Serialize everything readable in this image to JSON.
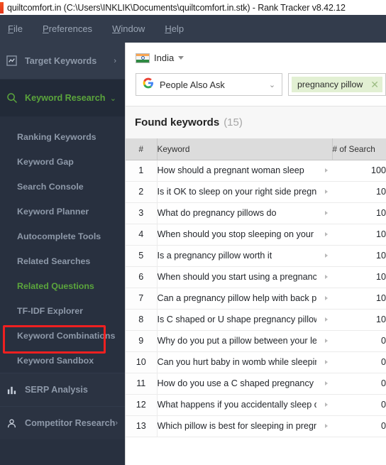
{
  "window": {
    "title": "quiltcomfort.in (C:\\Users\\INKLIK\\Documents\\quiltcomfort.in.stk) - Rank Tracker v8.42.12",
    "app_icon": "app-icon"
  },
  "menubar": {
    "items": [
      {
        "label": "File",
        "accel": "F"
      },
      {
        "label": "Preferences",
        "accel": "P"
      },
      {
        "label": "Window",
        "accel": "W"
      },
      {
        "label": "Help",
        "accel": "H"
      }
    ]
  },
  "sidebar": {
    "target_keywords": {
      "label": "Target Keywords",
      "icon": "chart-square-icon",
      "chevron": "›"
    },
    "keyword_research": {
      "label": "Keyword Research",
      "icon": "search-icon",
      "chevron": "⌄"
    },
    "subitems": [
      {
        "label": "Ranking Keywords",
        "selected": false
      },
      {
        "label": "Keyword Gap",
        "selected": false
      },
      {
        "label": "Search Console",
        "selected": false
      },
      {
        "label": "Keyword Planner",
        "selected": false
      },
      {
        "label": "Autocomplete Tools",
        "selected": false
      },
      {
        "label": "Related Searches",
        "selected": false
      },
      {
        "label": "Related Questions",
        "selected": true
      },
      {
        "label": "TF-IDF Explorer",
        "selected": false
      },
      {
        "label": "Keyword Combinations",
        "selected": false
      },
      {
        "label": "Keyword Sandbox",
        "selected": false
      }
    ],
    "serp_analysis": {
      "label": "SERP Analysis",
      "icon": "bar-chart-icon"
    },
    "competitor_research": {
      "label": "Competitor Research",
      "icon": "person-icon",
      "chevron": "›"
    },
    "annotation": {
      "color": "#ef2020",
      "target": "Related Questions"
    },
    "accent_green": "#5ba53c"
  },
  "toolbar": {
    "region": {
      "label": "India",
      "icon": "india-flag-icon"
    },
    "source_select": {
      "label": "People Also Ask",
      "icon": "google-icon"
    },
    "tag": {
      "label": "pregnancy pillow",
      "remove_icon": "close-icon"
    }
  },
  "results": {
    "heading": "Found keywords",
    "count": "(15)",
    "columns": [
      "#",
      "Keyword",
      "# of Search"
    ],
    "rows": [
      {
        "num": "1",
        "keyword": "How should a pregnant woman sleep",
        "volume": "100"
      },
      {
        "num": "2",
        "keyword": "Is it OK to sleep on your right side pregnant",
        "volume": "10"
      },
      {
        "num": "3",
        "keyword": "What do pregnancy pillows do",
        "volume": "10"
      },
      {
        "num": "4",
        "keyword": "When should you stop sleeping on your sto..",
        "volume": "10"
      },
      {
        "num": "5",
        "keyword": "Is a pregnancy pillow worth it",
        "volume": "10"
      },
      {
        "num": "6",
        "keyword": "When should you start using a pregnancy pil",
        "volume": "10"
      },
      {
        "num": "7",
        "keyword": "Can a pregnancy pillow help with back pain",
        "volume": "10"
      },
      {
        "num": "8",
        "keyword": "Is C shaped or U shape pregnancy pillow b..",
        "volume": "10"
      },
      {
        "num": "9",
        "keyword": "Why do you put a pillow between your legs w",
        "volume": "0"
      },
      {
        "num": "10",
        "keyword": "Can you hurt baby in womb while sleeping",
        "volume": "0"
      },
      {
        "num": "11",
        "keyword": "How do you use a C shaped pregnancy pillo",
        "volume": "0"
      },
      {
        "num": "12",
        "keyword": "What happens if you accidentally sleep on y..",
        "volume": "0"
      },
      {
        "num": "13",
        "keyword": "Which pillow is best for sleeping in pregnanc",
        "volume": "0"
      }
    ]
  }
}
